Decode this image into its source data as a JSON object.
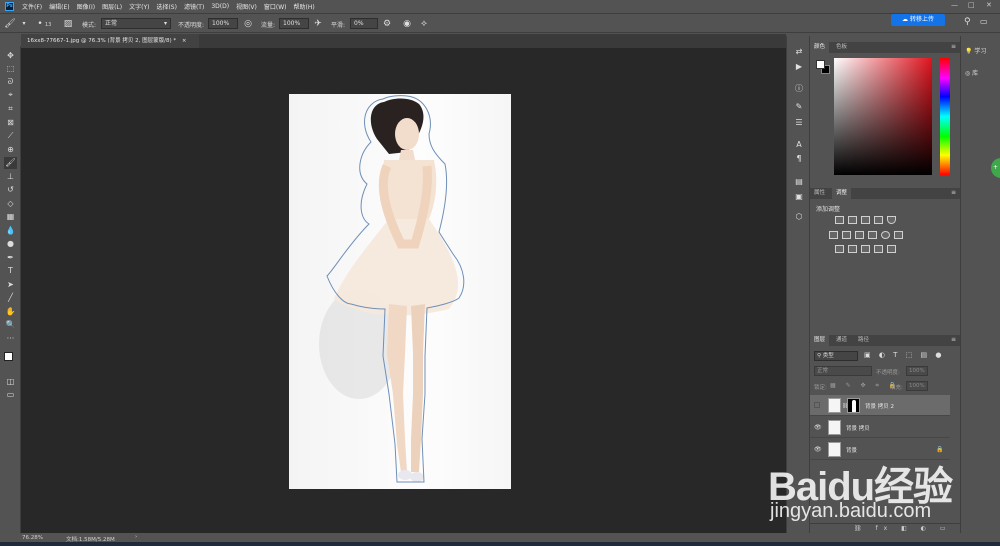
{
  "app": {
    "menus": [
      "文件(F)",
      "编辑(E)",
      "图像(I)",
      "图层(L)",
      "文字(Y)",
      "选择(S)",
      "滤镜(T)",
      "3D(D)",
      "视图(V)",
      "窗口(W)",
      "帮助(H)"
    ]
  },
  "options": {
    "mode_label": "模式:",
    "mode_value": "正常",
    "opacity_label": "不透明度:",
    "opacity_value": "100%",
    "flow_label": "流量:",
    "flow_value": "100%",
    "smooth_label": "平滑:",
    "smooth_value": "0%",
    "brush_size": "13",
    "cloud_button": "转移上传"
  },
  "document": {
    "tab_title": "16xx8-77667-1.jpg @ 76.3% (背景 拷贝 2, 图层蒙版/8) *",
    "close_glyph": "×"
  },
  "status": {
    "zoom": "76.28%",
    "doc_size": "文档:1.58M/5.28M"
  },
  "color_panel": {
    "tabs": [
      "颜色",
      "色板"
    ]
  },
  "adjust_panel": {
    "tabs": [
      "属性",
      "调整"
    ],
    "title": "添加调整"
  },
  "layers_panel": {
    "tabs": [
      "图层",
      "通道",
      "路径"
    ],
    "filter_kind": "类型",
    "blend_mode": "正常",
    "opacity_label": "不透明度:",
    "opacity_value": "100%",
    "lock_label": "锁定:",
    "fill_label": "填充:",
    "fill_value": "100%",
    "layers": [
      {
        "name": "背景 拷贝 2",
        "visible": false,
        "selected": true,
        "has_mask": true
      },
      {
        "name": "背景 拷贝",
        "visible": true,
        "selected": false,
        "has_mask": false
      },
      {
        "name": "背景",
        "visible": true,
        "selected": false,
        "has_mask": false,
        "locked": true
      }
    ]
  },
  "learn_panel": {
    "learn": "学习",
    "library": "库"
  },
  "watermark": {
    "brand": "Baidu经验",
    "url": "jingyan.baidu.com"
  },
  "colors": {
    "app_bg": "#535353",
    "canvas_bg": "#282828",
    "accent_blue": "#1473e6",
    "selection_path": "#6e8fb8"
  }
}
